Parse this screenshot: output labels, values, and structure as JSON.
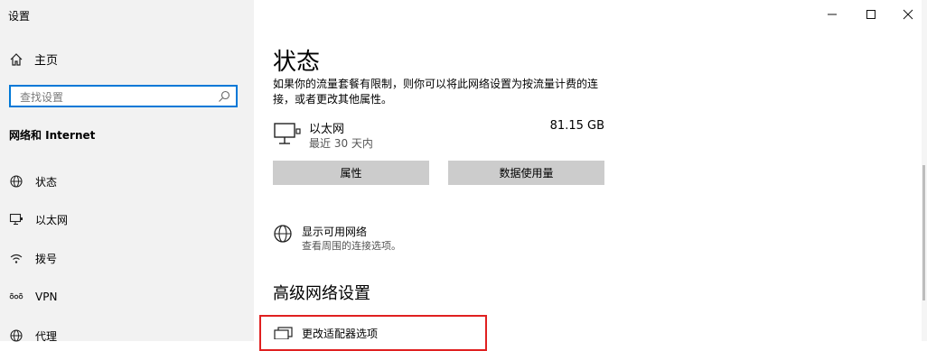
{
  "window": {
    "title": "设置"
  },
  "sidebar": {
    "home_label": "主页",
    "search_placeholder": "查找设置",
    "section_title": "网络和 Internet",
    "items": [
      {
        "label": "状态",
        "icon": "globe-status-icon"
      },
      {
        "label": "以太网",
        "icon": "ethernet-icon"
      },
      {
        "label": "拨号",
        "icon": "dialup-icon"
      },
      {
        "label": "VPN",
        "icon": "vpn-icon"
      },
      {
        "label": "代理",
        "icon": "globe-icon"
      }
    ]
  },
  "main": {
    "page_title": "状态",
    "description": "如果你的流量套餐有限制，则你可以将此网络设置为按流量计费的连接，或者更改其他属性。",
    "ethernet": {
      "name": "以太网",
      "status": "最近 30 天内",
      "usage": "81.15 GB"
    },
    "buttons": {
      "properties": "属性",
      "data_usage": "数据使用量"
    },
    "show_networks": {
      "title": "显示可用网络",
      "subtitle": "查看周围的连接选项。"
    },
    "advanced_title": "高级网络设置",
    "adapter_options": "更改适配器选项"
  },
  "colors": {
    "accent": "#0078d7",
    "highlight_border": "#e02020",
    "sidebar_bg": "#f2f2f2"
  }
}
